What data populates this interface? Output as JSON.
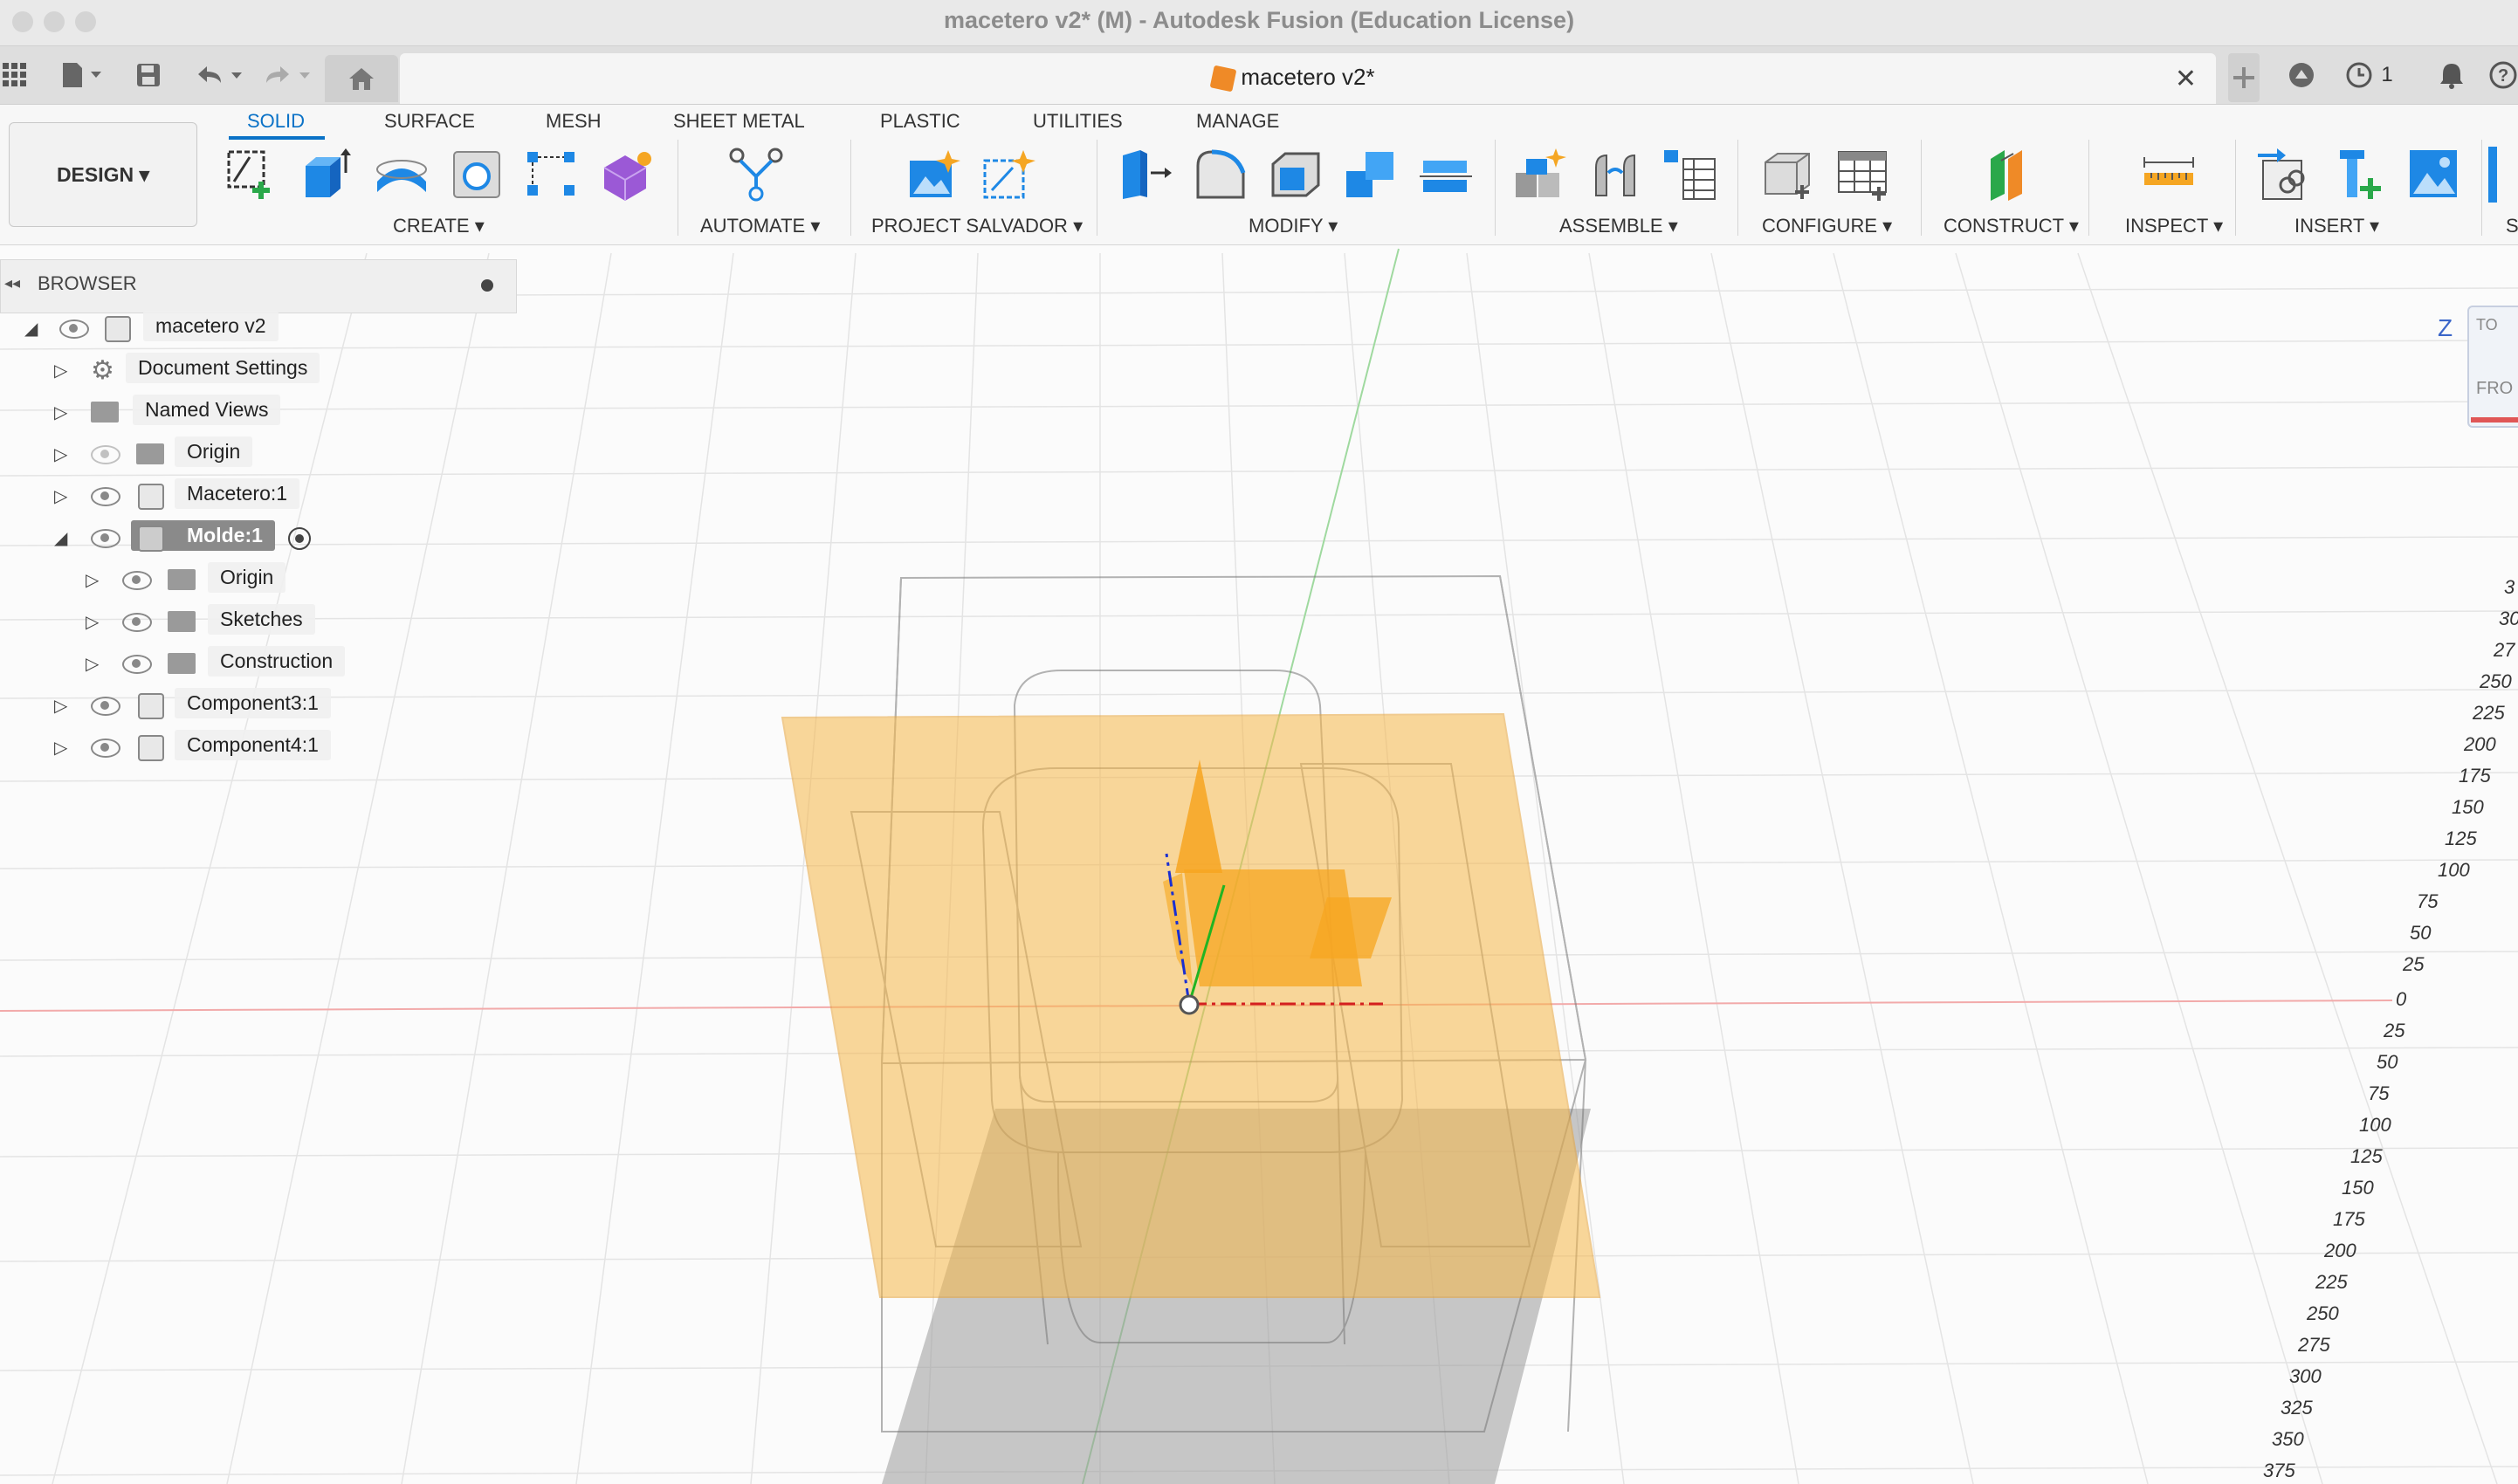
{
  "window": {
    "title": "macetero v2* (M) - Autodesk Fusion (Education License)"
  },
  "document_tab": {
    "label": "macetero v2*",
    "jobs_count": "1"
  },
  "ribbon": {
    "workspace": "DESIGN",
    "tabs": [
      "SOLID",
      "SURFACE",
      "MESH",
      "SHEET METAL",
      "PLASTIC",
      "UTILITIES",
      "MANAGE"
    ],
    "active_tab": "SOLID",
    "groups": [
      "CREATE",
      "AUTOMATE",
      "PROJECT SALVADOR",
      "MODIFY",
      "ASSEMBLE",
      "CONFIGURE",
      "CONSTRUCT",
      "INSPECT",
      "INSERT",
      "S"
    ]
  },
  "browser": {
    "title": "BROWSER",
    "items": [
      {
        "label": "macetero v2",
        "level": 0,
        "expanded": true
      },
      {
        "label": "Document Settings",
        "level": 1,
        "expanded": false
      },
      {
        "label": "Named Views",
        "level": 1,
        "expanded": false
      },
      {
        "label": "Origin",
        "level": 1,
        "expanded": false,
        "hidden": true
      },
      {
        "label": "Macetero:1",
        "level": 1,
        "expanded": false
      },
      {
        "label": "Molde:1",
        "level": 1,
        "expanded": true,
        "active": true
      },
      {
        "label": "Origin",
        "level": 2,
        "expanded": false
      },
      {
        "label": "Sketches",
        "level": 2,
        "expanded": false
      },
      {
        "label": "Construction",
        "level": 2,
        "expanded": false
      },
      {
        "label": "Component3:1",
        "level": 1,
        "expanded": false
      },
      {
        "label": "Component4:1",
        "level": 1,
        "expanded": false
      }
    ]
  },
  "viewcube": {
    "axis": "Z",
    "top": "TO",
    "front": "FRO"
  },
  "scale": {
    "upper": [
      "3",
      "30",
      "27",
      "250",
      "225",
      "200",
      "175",
      "150",
      "125",
      "100",
      "75",
      "50",
      "25",
      "0"
    ],
    "lower": [
      "25",
      "50",
      "75",
      "100",
      "125",
      "150",
      "175",
      "200",
      "225",
      "250",
      "275",
      "300",
      "325",
      "350",
      "375"
    ]
  },
  "colors": {
    "accent": "#0a72c7",
    "plane": "#f7b84a",
    "x_axis": "#d42020",
    "y_axis": "#22b422",
    "z_axis": "#1a2fd1"
  }
}
